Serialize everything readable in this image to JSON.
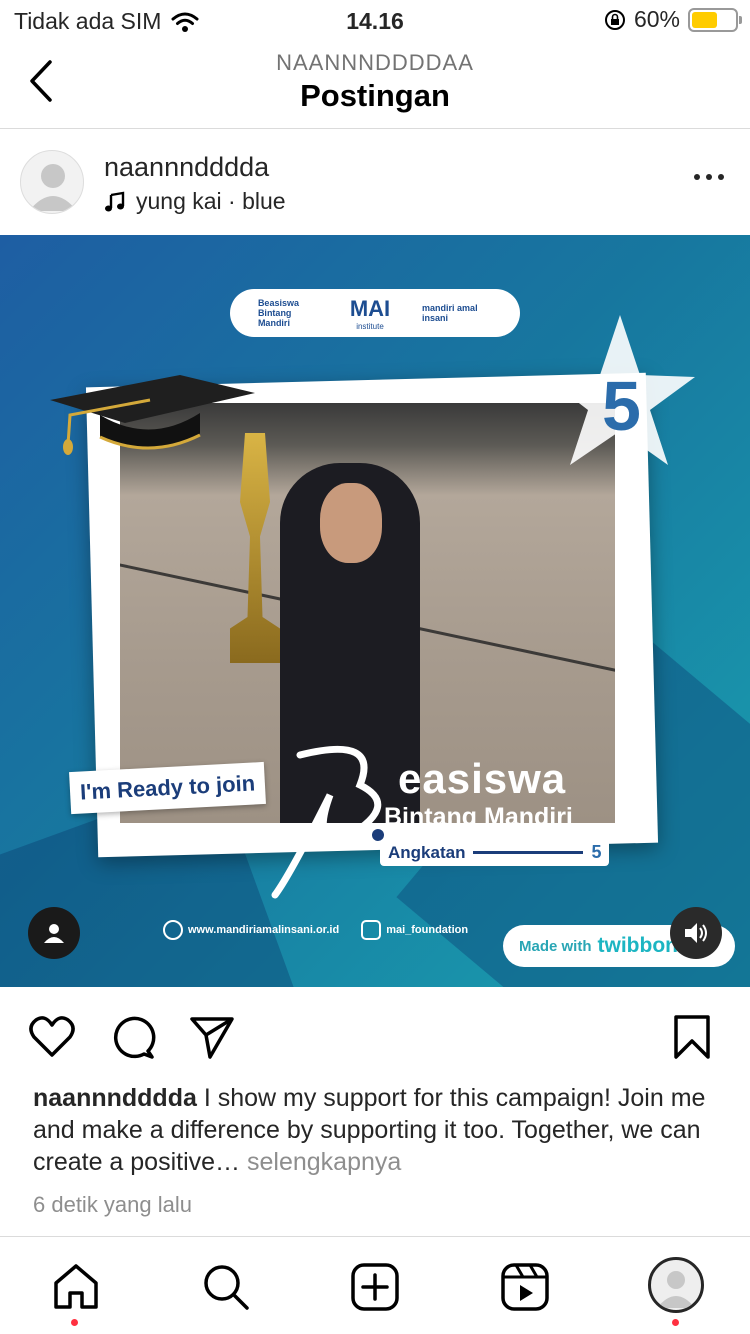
{
  "status_bar": {
    "carrier": "Tidak ada SIM",
    "time": "14.16",
    "battery": "60%",
    "battery_level": 0.6,
    "battery_color": "#ffcc00"
  },
  "header": {
    "subtitle": "NAANNNDDDDAA",
    "title": "Postingan",
    "back_icon": "chevron-left-icon"
  },
  "post": {
    "username": "naannndddda",
    "music": "yung kai · blue",
    "media": {
      "ready_label": "I'm Ready to join",
      "beasiswa": "easiswa",
      "bintang": "Bintang Mandiri",
      "angkatan": "Angkatan",
      "logo_beasiswa": "Beasiswa Bintang Mandiri",
      "logo_mai": "MAI",
      "logo_mai_sub": "institute",
      "logo_mandiri": "mandiri amal insani",
      "website": "www.mandiriamalinsani.or.id",
      "instagram": "mai_foundation",
      "made_with": "Made with",
      "twibbonize": "twibbonize"
    }
  },
  "caption": {
    "username": "naannndddda",
    "text": " I show my support for this campaign! Join me and make a difference by supporting it too. Together, we can create a positive…",
    "more": " selengkapnya",
    "time_ago": "6 detik yang lalu"
  },
  "tab_bar": {
    "items": [
      "home-icon",
      "search-icon",
      "new-post-icon",
      "reels-icon",
      "profile-icon"
    ]
  }
}
